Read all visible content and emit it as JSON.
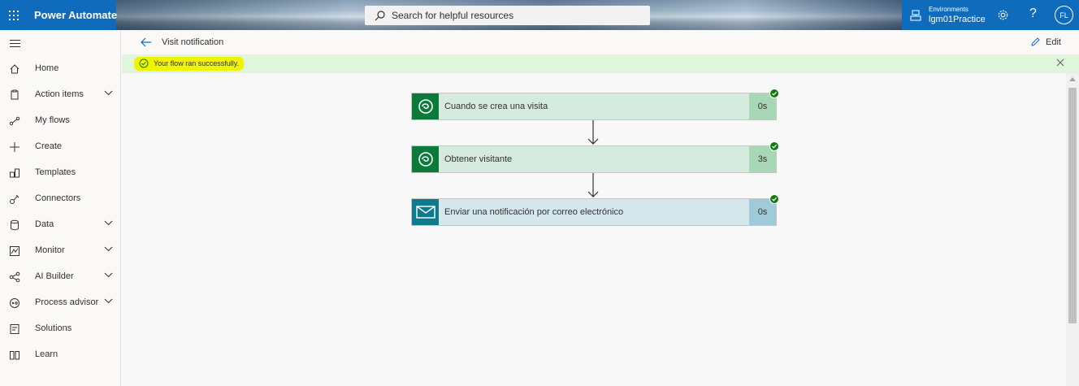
{
  "header": {
    "app_name": "Power Automate",
    "search_placeholder": "Search for helpful resources",
    "environment_label": "Environments",
    "environment_name": "lgm01Practice",
    "help_glyph": "?",
    "avatar_initials": "FL",
    "icons": [
      "waffle-icon",
      "search-icon",
      "environment-icon",
      "gear-icon",
      "help-icon"
    ]
  },
  "sidebar": {
    "items": [
      {
        "label": "Home",
        "icon": "home-icon",
        "expandable": false
      },
      {
        "label": "Action items",
        "icon": "clipboard-icon",
        "expandable": true
      },
      {
        "label": "My flows",
        "icon": "flow-icon",
        "expandable": false
      },
      {
        "label": "Create",
        "icon": "plus-icon",
        "expandable": false
      },
      {
        "label": "Templates",
        "icon": "templates-icon",
        "expandable": false
      },
      {
        "label": "Connectors",
        "icon": "connector-icon",
        "expandable": false
      },
      {
        "label": "Data",
        "icon": "database-icon",
        "expandable": true
      },
      {
        "label": "Monitor",
        "icon": "monitor-icon",
        "expandable": true
      },
      {
        "label": "AI Builder",
        "icon": "ai-builder-icon",
        "expandable": true
      },
      {
        "label": "Process advisor",
        "icon": "process-advisor-icon",
        "expandable": true
      },
      {
        "label": "Solutions",
        "icon": "solutions-icon",
        "expandable": false
      },
      {
        "label": "Learn",
        "icon": "book-icon",
        "expandable": false
      }
    ]
  },
  "command_bar": {
    "flow_title": "Visit notification",
    "edit_label": "Edit"
  },
  "banner": {
    "message": "Your flow ran successfully."
  },
  "flow_steps": [
    {
      "title": "Cuando se crea una visita",
      "duration": "0s",
      "icon": "dataverse-icon",
      "status": "succeeded"
    },
    {
      "title": "Obtener visitante",
      "duration": "3s",
      "icon": "dataverse-icon",
      "status": "succeeded"
    },
    {
      "title": "Enviar una notificación por correo electrónico",
      "duration": "0s",
      "icon": "mail-icon",
      "status": "succeeded"
    }
  ],
  "colors": {
    "header_blue": "#0f6cbd",
    "success_banner": "#dff6dd",
    "highlight": "#f0f400",
    "dataverse_green": "#0b7a3b",
    "mail_teal": "#0e7a8c",
    "success_check": "#107c10"
  }
}
